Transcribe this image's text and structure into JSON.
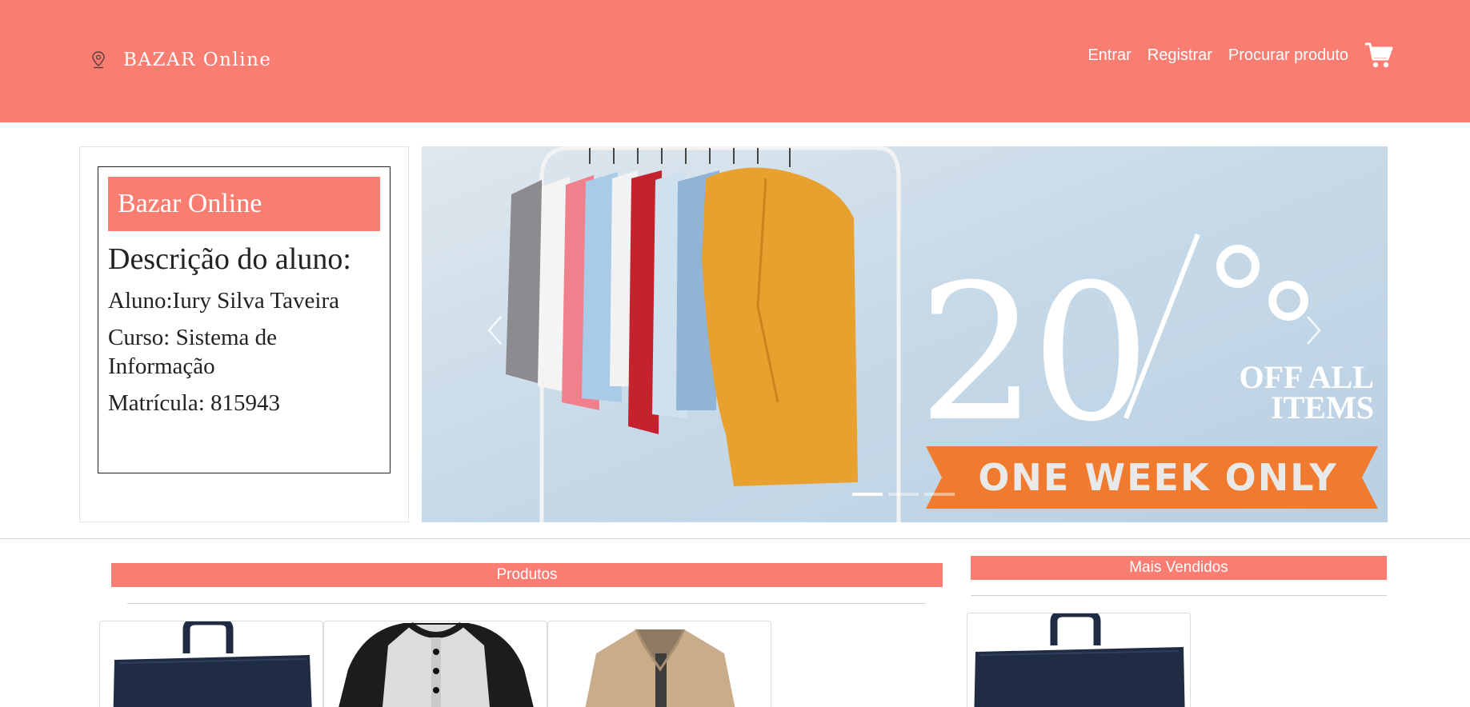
{
  "navbar": {
    "brand": "BAZAR Online",
    "links": [
      "Entrar",
      "Registrar",
      "Procurar produto"
    ],
    "cart_icon": "shopping-cart-icon",
    "brand_icon": "map-pin-icon"
  },
  "student_card": {
    "title": "Bazar Online",
    "heading": "Descrição do aluno:",
    "aluno": "Aluno:Iury Silva Taveira",
    "curso": "Curso: Sistema de Informação",
    "matricula": "Matrícula: 815943"
  },
  "carousel": {
    "promo_percent": "20%",
    "promo_off_line1": "OFF ALL",
    "promo_off_line2": "ITEMS",
    "promo_week": "ONE WEEK ONLY",
    "prev_icon": "chevron-left-icon",
    "next_icon": "chevron-right-icon",
    "slide_count": 3,
    "active_slide": 1
  },
  "sections": {
    "produtos": "Produtos",
    "mais_vendidos": "Mais Vendidos"
  },
  "products": [
    "backpack-image",
    "raglan-shirt-image",
    "jacket-image"
  ],
  "best_sellers": [
    "backpack-image"
  ],
  "colors": {
    "accent": "#fa7d72",
    "coat": "#e8a12e",
    "banner": "#f07a2e"
  }
}
